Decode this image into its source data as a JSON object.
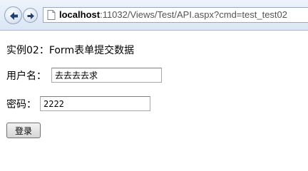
{
  "browser": {
    "url_host": "localhost",
    "url_rest": ":11032/Views/Test/API.aspx?cmd=test_test02",
    "back_icon": "back-arrow-icon",
    "forward_icon": "forward-arrow-icon",
    "page_icon": "page-icon"
  },
  "page": {
    "heading": "实例02：Form表单提交数据",
    "username_label": "用户名：",
    "username_value": "去去去去求",
    "password_label": "密码：",
    "password_value": "2222",
    "submit_label": "登录"
  },
  "colors": {
    "toolbar_bg": "#dbe6f5",
    "arrow": "#1e3f78",
    "url_path": "#555555"
  }
}
